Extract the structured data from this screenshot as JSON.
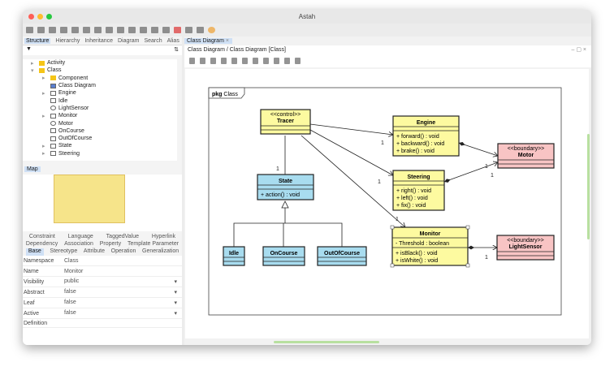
{
  "app": {
    "title": "Astah"
  },
  "colors": {
    "class_fill": "#fdfaa0",
    "state_fill": "#a8dcef",
    "boundary_fill": "#f8c4c4",
    "selection": "#cfe0f5"
  },
  "left": {
    "tabs": [
      "Structure",
      "Hierarchy",
      "Inheritance",
      "Diagram",
      "Search",
      "Alias"
    ],
    "tree": [
      {
        "label": "Activity",
        "icon": "folder-icon",
        "depth": 0,
        "expander": "collapsed"
      },
      {
        "label": "Class",
        "icon": "folder-icon",
        "depth": 0,
        "expander": "expanded"
      },
      {
        "label": "Component",
        "icon": "folder-icon",
        "depth": 1,
        "expander": "collapsed"
      },
      {
        "label": "Class Diagram",
        "icon": "class-diagram-icon",
        "depth": 1,
        "expander": ""
      },
      {
        "label": "Engine",
        "icon": "class-icon",
        "depth": 1,
        "expander": "collapsed"
      },
      {
        "label": "Idle",
        "icon": "class-icon",
        "depth": 1,
        "expander": ""
      },
      {
        "label": "LightSensor",
        "icon": "boundary-icon",
        "depth": 1,
        "expander": ""
      },
      {
        "label": "Monitor",
        "icon": "class-icon",
        "depth": 1,
        "expander": "collapsed"
      },
      {
        "label": "Motor",
        "icon": "boundary-icon",
        "depth": 1,
        "expander": ""
      },
      {
        "label": "OnCourse",
        "icon": "class-icon",
        "depth": 1,
        "expander": ""
      },
      {
        "label": "OutOfCourse",
        "icon": "class-icon",
        "depth": 1,
        "expander": ""
      },
      {
        "label": "State",
        "icon": "class-icon",
        "depth": 1,
        "expander": "collapsed"
      },
      {
        "label": "Steering",
        "icon": "class-icon",
        "depth": 1,
        "expander": "collapsed"
      }
    ],
    "map_tab": "Map",
    "prop_tabs_row1": [
      "Constraint",
      "Language",
      "TaggedValue",
      "Hyperlink"
    ],
    "prop_tabs_row2": [
      "Dependency",
      "Association",
      "Property",
      "Template Parameter"
    ],
    "prop_tabs_row3": [
      "Base",
      "Stereotype",
      "Attribute",
      "Operation",
      "Generalization"
    ],
    "props": {
      "namespace_label": "Namespace",
      "namespace": "Class",
      "name_label": "Name",
      "name": "Monitor",
      "visibility_label": "Visibility",
      "visibility": "public",
      "abstract_label": "Abstract",
      "abstract": "false",
      "leaf_label": "Leaf",
      "leaf": "false",
      "active_label": "Active",
      "active": "false",
      "definition_label": "Definition"
    }
  },
  "editor": {
    "tab": "Class Diagram",
    "breadcrumb": "Class Diagram / Class Diagram [Class]"
  },
  "diagram": {
    "package": "Class",
    "pkg_keyword": "pkg",
    "tracer": {
      "stereo": "<<control>>",
      "name": "Tracer"
    },
    "engine": {
      "name": "Engine",
      "ops": [
        "+ forward() : void",
        "+ backward() : void",
        "+ brake() : void"
      ]
    },
    "motor": {
      "stereo": "<<boundary>>",
      "name": "Motor"
    },
    "steering": {
      "name": "Steering",
      "ops": [
        "+ right() : void",
        "+ left() : void",
        "+ fix() : void"
      ]
    },
    "state": {
      "name": "State",
      "ops": [
        "+ action() : void"
      ]
    },
    "monitor": {
      "name": "Monitor",
      "attrs": [
        "- Threshold : boolean"
      ],
      "ops": [
        "+ isBlack() : void",
        "+ isWhite() : void"
      ]
    },
    "lightsensor": {
      "stereo": "<<boundary>>",
      "name": "LightSensor"
    },
    "idle": {
      "name": "Idle"
    },
    "oncourse": {
      "name": "OnCourse"
    },
    "outofcourse": {
      "name": "OutOfCourse"
    },
    "mult": {
      "one": "1"
    }
  }
}
